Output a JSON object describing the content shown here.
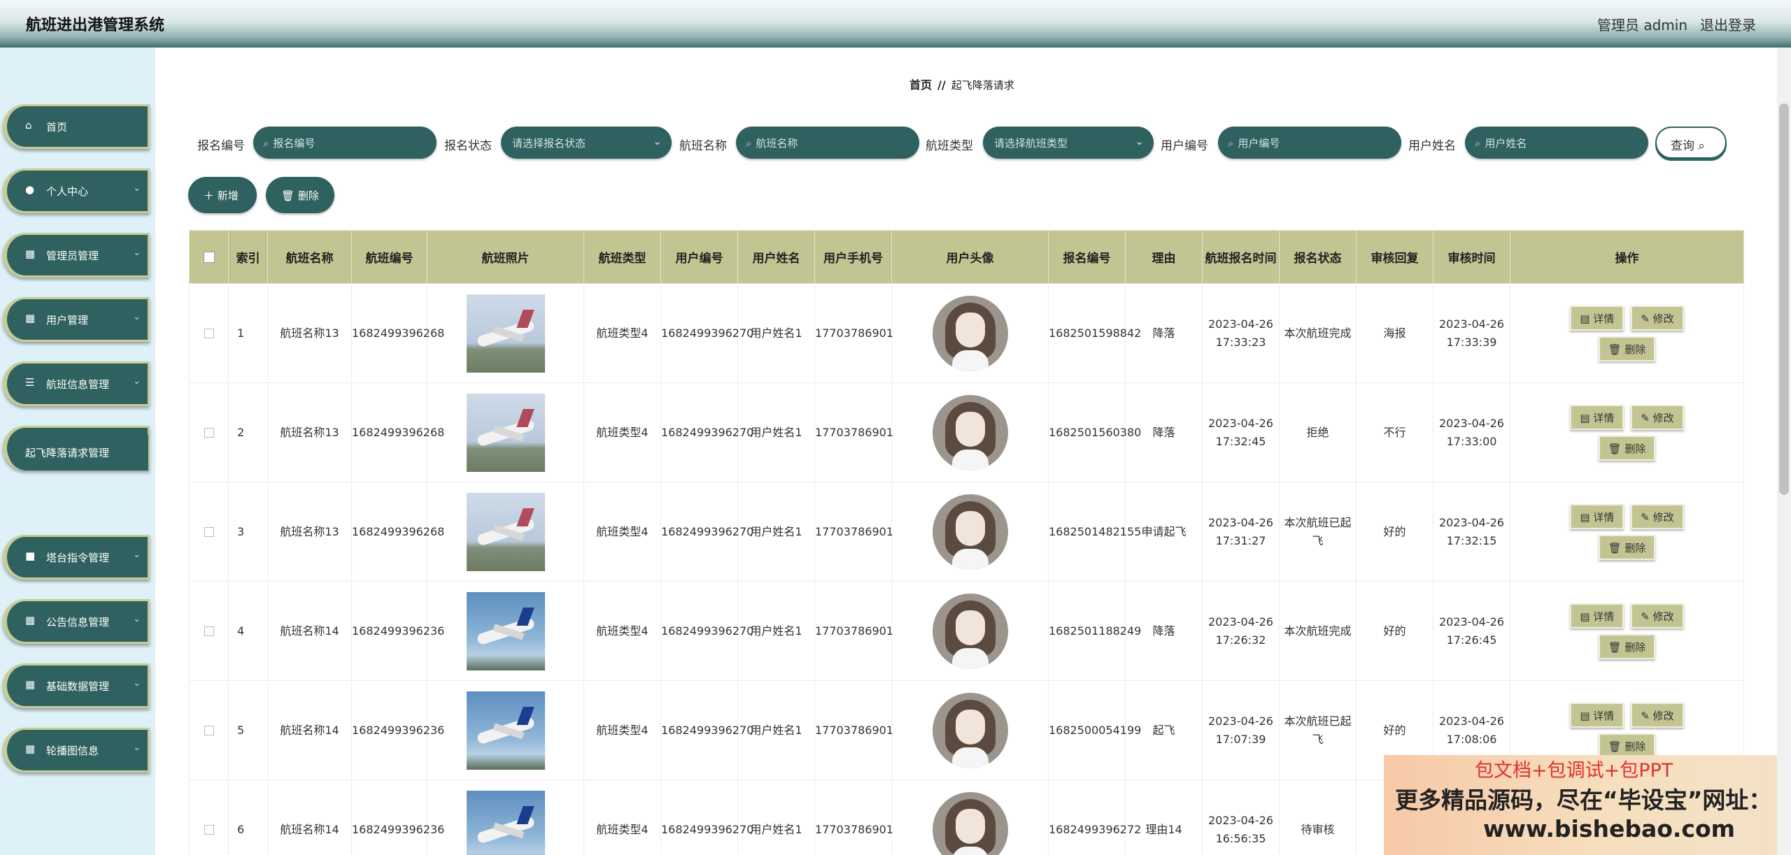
{
  "header": {
    "app_title": "航班进出港管理系统",
    "admin_label": "管理员 admin",
    "logout": "退出登录"
  },
  "sidebar": {
    "items": [
      {
        "label": "首页",
        "icon": "home-icon",
        "glyph": "⌂",
        "chevron": false
      },
      {
        "label": "个人中心",
        "icon": "user-icon",
        "glyph": "●",
        "chevron": true
      },
      {
        "label": "管理员管理",
        "icon": "grid-icon",
        "glyph": "▦",
        "chevron": true
      },
      {
        "label": "用户管理",
        "icon": "grid-icon",
        "glyph": "▦",
        "chevron": true
      },
      {
        "label": "航班信息管理",
        "icon": "list-icon",
        "glyph": "☰",
        "chevron": true
      },
      {
        "label": "起飞降落请求管理",
        "icon": "location-icon",
        "glyph": "◉",
        "chevron": true
      },
      {
        "label": "塔台指令管理",
        "icon": "briefcase-icon",
        "glyph": "■",
        "chevron": true
      },
      {
        "label": "公告信息管理",
        "icon": "grid-icon",
        "glyph": "▦",
        "chevron": true
      },
      {
        "label": "基础数据管理",
        "icon": "grid-icon",
        "glyph": "▦",
        "chevron": true
      },
      {
        "label": "轮播图信息",
        "icon": "grid-icon",
        "glyph": "▦",
        "chevron": true
      }
    ],
    "active_sub": "起飞降落请求管理"
  },
  "breadcrumb": {
    "home": "首页",
    "sep": "//",
    "current": "起飞降落请求"
  },
  "search": {
    "fields": [
      {
        "label": "报名编号",
        "type": "input",
        "placeholder": "报名编号"
      },
      {
        "label": "报名状态",
        "type": "select",
        "placeholder": "请选择报名状态"
      },
      {
        "label": "航班名称",
        "type": "input",
        "placeholder": "航班名称"
      },
      {
        "label": "航班类型",
        "type": "select",
        "placeholder": "请选择航班类型"
      },
      {
        "label": "用户编号",
        "type": "input",
        "placeholder": "用户编号"
      },
      {
        "label": "用户姓名",
        "type": "input",
        "placeholder": "用户姓名"
      }
    ],
    "query_button": "查询"
  },
  "actions": {
    "add": "新增",
    "delete": "删除"
  },
  "table": {
    "headers": [
      "索引",
      "航班名称",
      "航班编号",
      "航班照片",
      "航班类型",
      "用户编号",
      "用户姓名",
      "用户手机号",
      "用户头像",
      "报名编号",
      "理由",
      "航班报名时间",
      "报名状态",
      "审核回复",
      "审核时间",
      "操作"
    ],
    "op_labels": {
      "detail": "详情",
      "edit": "修改",
      "delete": "删除"
    },
    "rows": [
      {
        "index": "1",
        "flight_name": "航班名称13",
        "flight_no": "1682499396268",
        "photo": "plane-photo-a",
        "flight_type": "航班类型4",
        "user_no": "1682499396270",
        "user_name": "用户姓名1",
        "phone": "17703786901",
        "apply_no": "1682501598842",
        "reason": "降落",
        "apply_time": "2023-04-26 17:33:23",
        "status": "本次航班完成",
        "reply": "海报",
        "review_time": "2023-04-26 17:33:39"
      },
      {
        "index": "2",
        "flight_name": "航班名称13",
        "flight_no": "1682499396268",
        "photo": "plane-photo-a",
        "flight_type": "航班类型4",
        "user_no": "1682499396270",
        "user_name": "用户姓名1",
        "phone": "17703786901",
        "apply_no": "1682501560380",
        "reason": "降落",
        "apply_time": "2023-04-26 17:32:45",
        "status": "拒绝",
        "reply": "不行",
        "review_time": "2023-04-26 17:33:00"
      },
      {
        "index": "3",
        "flight_name": "航班名称13",
        "flight_no": "1682499396268",
        "photo": "plane-photo-a",
        "flight_type": "航班类型4",
        "user_no": "1682499396270",
        "user_name": "用户姓名1",
        "phone": "17703786901",
        "apply_no": "1682501482155",
        "reason": "申请起飞",
        "apply_time": "2023-04-26 17:31:27",
        "status": "本次航班已起飞",
        "reply": "好的",
        "review_time": "2023-04-26 17:32:15"
      },
      {
        "index": "4",
        "flight_name": "航班名称14",
        "flight_no": "1682499396236",
        "photo": "plane-photo-b",
        "flight_type": "航班类型4",
        "user_no": "1682499396270",
        "user_name": "用户姓名1",
        "phone": "17703786901",
        "apply_no": "1682501188249",
        "reason": "降落",
        "apply_time": "2023-04-26 17:26:32",
        "status": "本次航班完成",
        "reply": "好的",
        "review_time": "2023-04-26 17:26:45"
      },
      {
        "index": "5",
        "flight_name": "航班名称14",
        "flight_no": "1682499396236",
        "photo": "plane-photo-b",
        "flight_type": "航班类型4",
        "user_no": "1682499396270",
        "user_name": "用户姓名1",
        "phone": "17703786901",
        "apply_no": "1682500054199",
        "reason": "起飞",
        "apply_time": "2023-04-26 17:07:39",
        "status": "本次航班已起飞",
        "reply": "好的",
        "review_time": "2023-04-26 17:08:06"
      },
      {
        "index": "6",
        "flight_name": "航班名称14",
        "flight_no": "1682499396236",
        "photo": "plane-photo-b",
        "flight_type": "航班类型4",
        "user_no": "1682499396270",
        "user_name": "用户姓名1",
        "phone": "17703786901",
        "apply_no": "1682499396272",
        "reason": "理由14",
        "apply_time": "2023-04-26 16:56:35",
        "status": "待审核",
        "reply": "",
        "review_time": ""
      }
    ]
  },
  "ad": {
    "line1": "包文档+包调试+包PPT",
    "line2": "更多精品源码，尽在“毕设宝”网址：",
    "line3": "www.bishebao.com"
  },
  "colors": {
    "primary": "#2e615f",
    "accent": "#c2c492",
    "sidebar_bg": "#dff1f8"
  }
}
